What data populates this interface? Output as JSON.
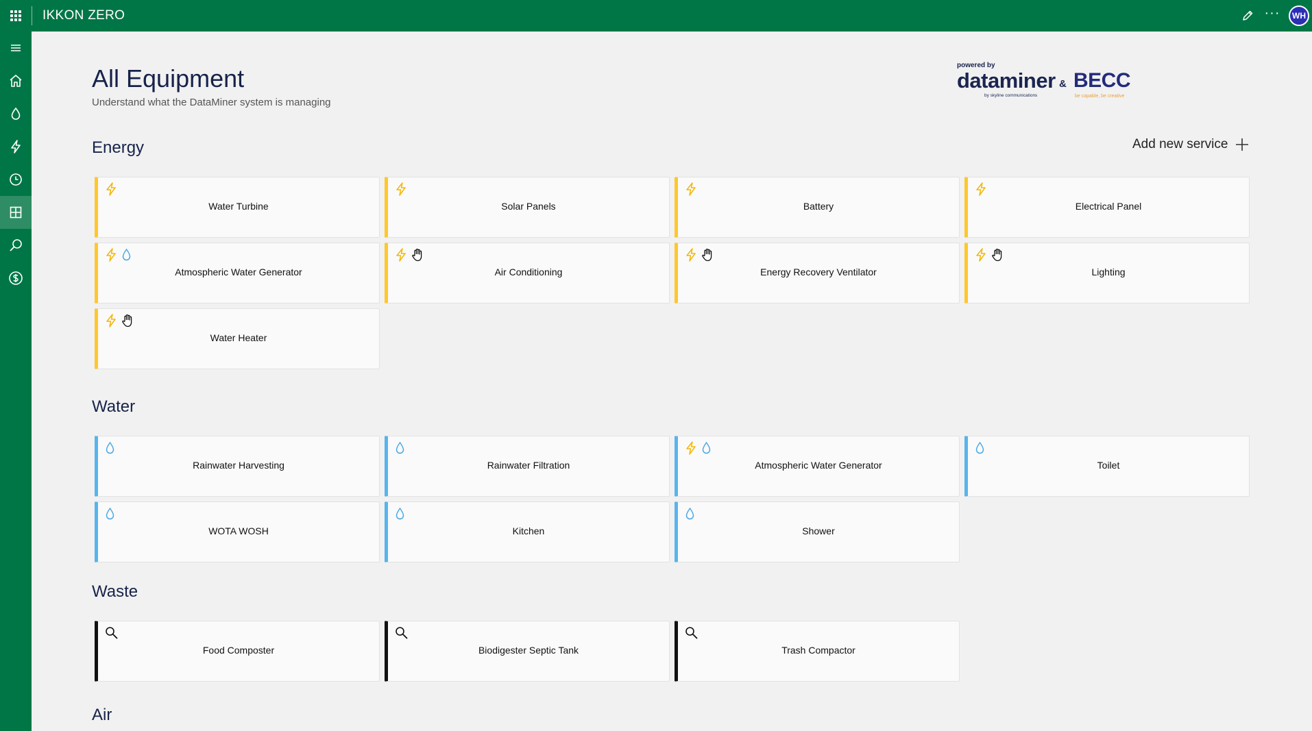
{
  "topbar": {
    "app_title": "IKKON ZERO",
    "avatar_initials": "WH"
  },
  "sidebar": {
    "items": [
      {
        "name": "menu",
        "icon": "hamburger-icon"
      },
      {
        "name": "home",
        "icon": "home-icon"
      },
      {
        "name": "water",
        "icon": "water-drop-icon"
      },
      {
        "name": "energy",
        "icon": "lightning-icon"
      },
      {
        "name": "history",
        "icon": "clock-icon"
      },
      {
        "name": "equipment",
        "icon": "grid-icon",
        "active": true
      },
      {
        "name": "search",
        "icon": "search-icon"
      },
      {
        "name": "cost",
        "icon": "dollar-icon"
      }
    ]
  },
  "page": {
    "title": "All Equipment",
    "subtitle": "Understand what the DataMiner system is managing"
  },
  "logo": {
    "powered_by": "powered by",
    "dataminer": "dataminer",
    "dataminer_tag": "by skyline communications",
    "ampersand": "&",
    "becc": "BECC",
    "becc_tag": "be capable, be creative"
  },
  "add_service": {
    "label": "Add new service"
  },
  "colors": {
    "brand_green": "#007646",
    "energy_yellow": "#ffc72c",
    "water_blue": "#58b4ec",
    "waste_black": "#111111"
  },
  "sections": {
    "energy": {
      "title": "Energy",
      "cards": [
        {
          "label": "Water Turbine",
          "icons": [
            "lightning-icon"
          ]
        },
        {
          "label": "Solar Panels",
          "icons": [
            "lightning-icon"
          ]
        },
        {
          "label": "Battery",
          "icons": [
            "lightning-icon"
          ]
        },
        {
          "label": "Electrical Panel",
          "icons": [
            "lightning-icon"
          ]
        },
        {
          "label": "Atmospheric Water Generator",
          "icons": [
            "lightning-icon",
            "water-drop-icon"
          ]
        },
        {
          "label": "Air Conditioning",
          "icons": [
            "lightning-icon",
            "hand-icon"
          ]
        },
        {
          "label": "Energy Recovery Ventilator",
          "icons": [
            "lightning-icon",
            "hand-icon"
          ]
        },
        {
          "label": "Lighting",
          "icons": [
            "lightning-icon",
            "hand-icon"
          ]
        },
        {
          "label": "Water Heater",
          "icons": [
            "lightning-icon",
            "hand-icon"
          ]
        }
      ]
    },
    "water": {
      "title": "Water",
      "cards": [
        {
          "label": "Rainwater Harvesting",
          "icons": [
            "water-drop-icon"
          ]
        },
        {
          "label": "Rainwater Filtration",
          "icons": [
            "water-drop-icon"
          ]
        },
        {
          "label": "Atmospheric Water Generator",
          "icons": [
            "lightning-icon",
            "water-drop-icon"
          ]
        },
        {
          "label": "Toilet",
          "icons": [
            "water-drop-icon"
          ]
        },
        {
          "label": "WOTA WOSH",
          "icons": [
            "water-drop-icon"
          ]
        },
        {
          "label": "Kitchen",
          "icons": [
            "water-drop-icon"
          ]
        },
        {
          "label": "Shower",
          "icons": [
            "water-drop-icon"
          ]
        }
      ]
    },
    "waste": {
      "title": "Waste",
      "cards": [
        {
          "label": "Food Composter",
          "icons": [
            "magnifier-icon"
          ]
        },
        {
          "label": "Biodigester Septic Tank",
          "icons": [
            "magnifier-icon"
          ]
        },
        {
          "label": "Trash Compactor",
          "icons": [
            "magnifier-icon"
          ]
        }
      ]
    },
    "air": {
      "title": "Air"
    }
  }
}
